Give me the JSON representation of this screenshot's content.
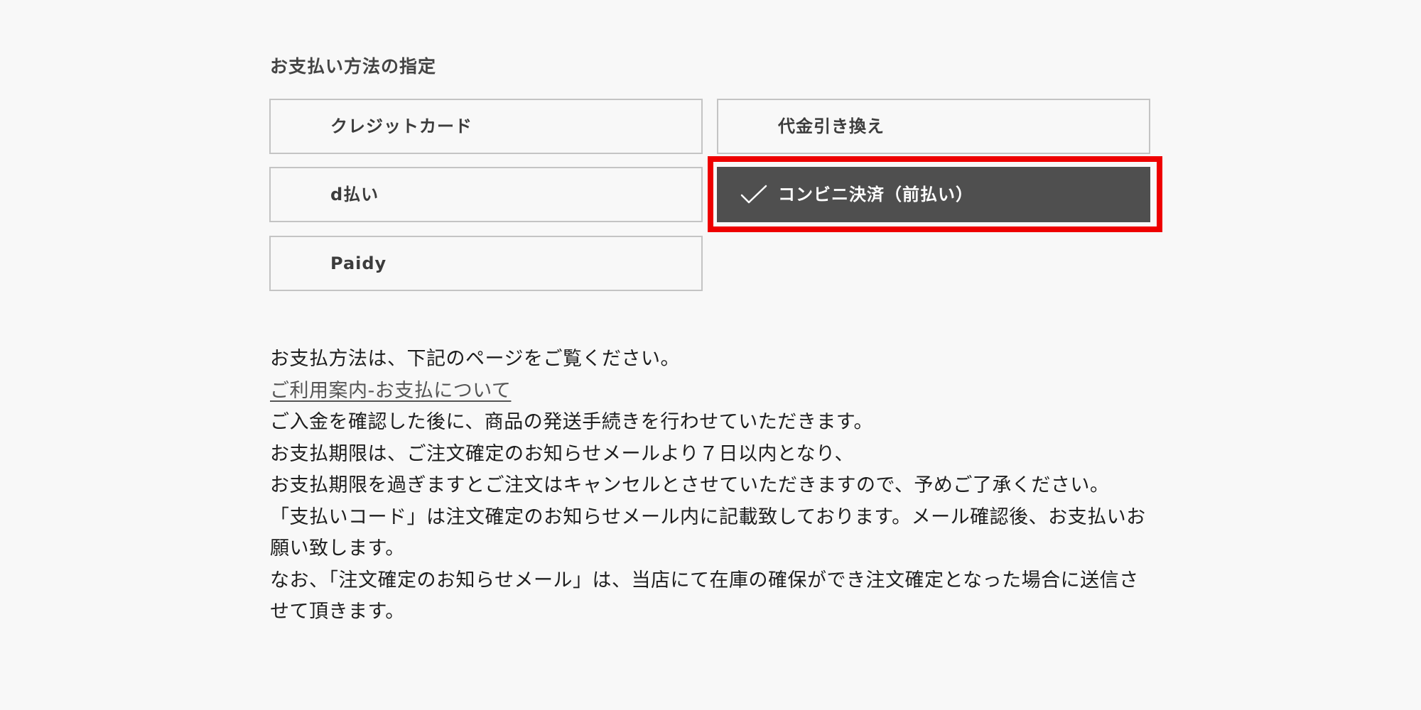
{
  "section": {
    "title": "お支払い方法の指定"
  },
  "payment_options": [
    {
      "id": "credit",
      "label": "クレジットカード",
      "selected": false
    },
    {
      "id": "cod",
      "label": "代金引き換え",
      "selected": false
    },
    {
      "id": "dpay",
      "label": "d払い",
      "selected": false
    },
    {
      "id": "conv",
      "label": "コンビニ決済（前払い）",
      "selected": true,
      "icon": "checkmark-icon"
    },
    {
      "id": "paidy",
      "label": "Paidy",
      "selected": false
    }
  ],
  "colors": {
    "selected_bg": "#4f4f4f",
    "highlight": "#ee0000",
    "border": "#c4c4c4",
    "background": "#f8f8f8"
  },
  "info": {
    "line1": "お支払方法は、下記のページをご覧ください。",
    "link_label": "ご利用案内-お支払について",
    "line2": "ご入金を確認した後に、商品の発送手続きを行わせていただきます。",
    "line3": "お支払期限は、ご注文確定のお知らせメールより７日以内となり、",
    "line4": "お支払期限を過ぎますとご注文はキャンセルとさせていただきますので、予めご了承ください。",
    "line5": "「支払いコード」は注文確定のお知らせメール内に記載致しております。メール確認後、お支払いお願い致します。",
    "line6": "なお、「注文確定のお知らせメール」は、当店にて在庫の確保ができ注文確定となった場合に送信させて頂きます。"
  }
}
